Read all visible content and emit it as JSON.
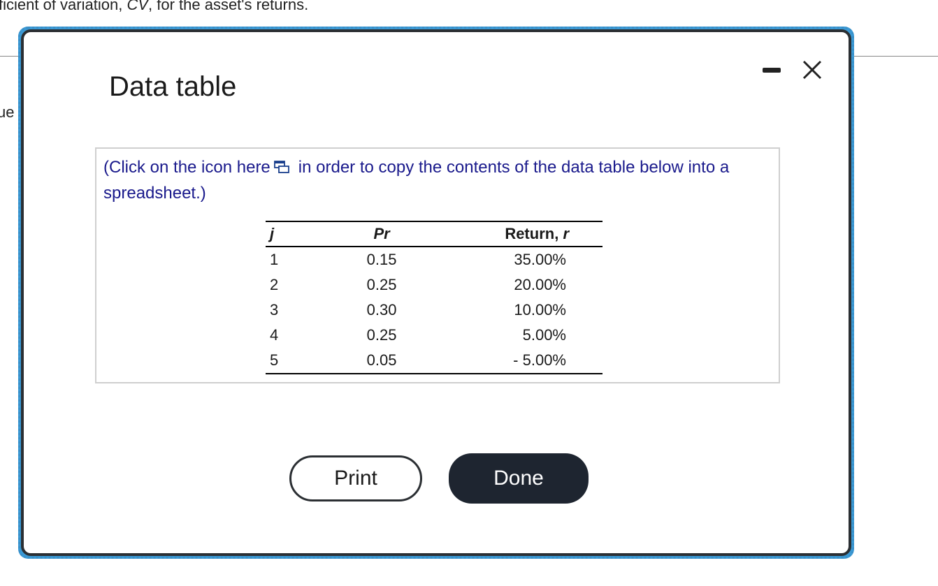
{
  "background": {
    "question_prefix": "ficient of variation, ",
    "question_italic": "CV",
    "question_suffix": ", for the asset's returns.",
    "left_cut_text": "ue"
  },
  "dialog": {
    "title": "Data table",
    "instructions_before_icon": "(Click on the icon here",
    "instructions_after_icon": "in order to copy the contents of the data table below into a spreadsheet.)",
    "copy_icon": "copy-spreadsheet-icon",
    "minimize_icon": "minimize-icon",
    "close_icon": "close-icon"
  },
  "table": {
    "headers": {
      "j": "j",
      "pr": "Pr",
      "return_label": "Return, ",
      "return_var": "r"
    },
    "rows": [
      {
        "j": "1",
        "pr": "0.15",
        "r": "35.00%"
      },
      {
        "j": "2",
        "pr": "0.25",
        "r": "20.00%"
      },
      {
        "j": "3",
        "pr": "0.30",
        "r": "10.00%"
      },
      {
        "j": "4",
        "pr": "0.25",
        "r": "5.00%"
      },
      {
        "j": "5",
        "pr": "0.05",
        "r": "- 5.00%"
      }
    ]
  },
  "buttons": {
    "print": "Print",
    "done": "Done"
  },
  "colors": {
    "accent_focus": "#3a9ad6",
    "done_bg": "#1e2530",
    "instruction_text": "#1a1a8c"
  }
}
